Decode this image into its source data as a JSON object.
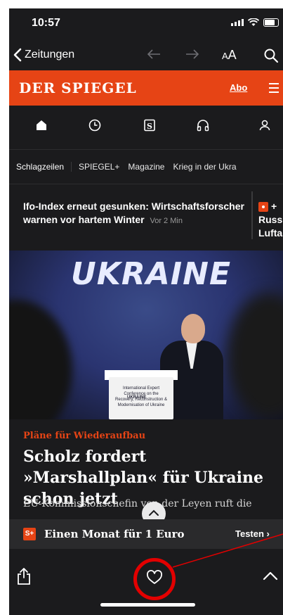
{
  "status": {
    "time": "10:57"
  },
  "nav": {
    "back_label": "Zeitungen",
    "text_size_small": "A",
    "text_size_large": "A"
  },
  "brand": {
    "logo": "DER SPIEGEL",
    "abo": "Abo"
  },
  "tabs": [
    "Schlagzeilen",
    "SPIEGEL+",
    "Magazine",
    "Krieg in der Ukra"
  ],
  "ticker": {
    "main": "Ifo-Index erneut gesunken: Wirtschaftsforscher warnen vor hartem Winter",
    "time": "Vor 2 Min",
    "side_line1": "+",
    "side_line2": "Russ",
    "side_line3": "Lufta"
  },
  "hero": {
    "word": "UKRAINE",
    "podium_line": "International Expert Conference on the Recovery, Reconstruction & Modernisation of Ukraine",
    "podium_word": "UKRAINE"
  },
  "article": {
    "kicker": "Pläne für Wiederaufbau",
    "headline": "Scholz fordert »Marshallplan« für Ukraine schon jetzt",
    "teaser": "EU-Kommissionschefin von der Leyen ruft die"
  },
  "promo": {
    "badge": "S+",
    "text": "Einen Monat für 1 Euro",
    "cta": "Testen ›"
  },
  "icons": {
    "nav": [
      "chevron-left-icon",
      "arrow-left-icon",
      "arrow-right-icon",
      "text-size-icon",
      "search-icon"
    ],
    "section": [
      "home-icon",
      "clock-icon",
      "spiegel-s-icon",
      "headphones-icon",
      "user-icon"
    ],
    "toolbar": [
      "share-icon",
      "heart-icon",
      "chevron-up-icon"
    ]
  },
  "colors": {
    "brand_red": "#e64415",
    "background": "#1b1b1d",
    "annotation": "#e30000"
  }
}
